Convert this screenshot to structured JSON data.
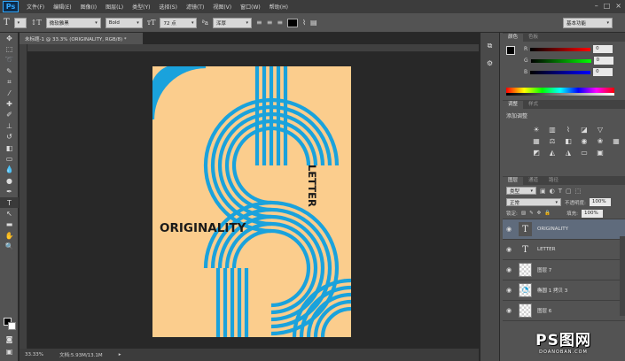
{
  "app": {
    "logo": "Ps"
  },
  "menu": [
    "文件(F)",
    "编辑(E)",
    "图像(I)",
    "图层(L)",
    "类型(Y)",
    "选择(S)",
    "滤镜(T)",
    "视图(V)",
    "窗口(W)",
    "帮助(H)"
  ],
  "window_controls": [
    "–",
    "□",
    "×"
  ],
  "options": {
    "font_family": "微软雅黑",
    "font_style": "Bold",
    "font_size": "72 点",
    "antialias": "浑厚",
    "text_color": "#000000",
    "workspace": "基本功能"
  },
  "document": {
    "tab_title": "未标题-1 @ 33.3% (ORIGINALITY, RGB/8) *",
    "zoom": "33.33%",
    "file_info": "文档:5.93M/13.1M",
    "poster": {
      "background": "#fbcd8d",
      "stripe_color": "#1aa2dc",
      "text_horizontal": "ORIGINALITY",
      "text_vertical": "LETTER"
    }
  },
  "color_panel": {
    "tabs": [
      "颜色",
      "色板"
    ],
    "channels": [
      {
        "label": "R",
        "value": "0"
      },
      {
        "label": "G",
        "value": "0"
      },
      {
        "label": "B",
        "value": "0"
      }
    ]
  },
  "adjustments_panel": {
    "tabs": [
      "调整",
      "样式"
    ],
    "heading": "添加调整"
  },
  "layers_panel": {
    "tabs": [
      "图层",
      "通道",
      "路径"
    ],
    "filter_label": "类型",
    "blend_mode": "正常",
    "opacity_label": "不透明度:",
    "opacity_value": "100%",
    "lock_label": "锁定:",
    "fill_label": "填充:",
    "fill_value": "100%",
    "layers": [
      {
        "name": "ORIGINALITY",
        "kind": "text",
        "selected": true
      },
      {
        "name": "LETTER",
        "kind": "text",
        "selected": false
      },
      {
        "name": "图层 7",
        "kind": "raster",
        "selected": false
      },
      {
        "name": "椭圆 1 拷贝 3",
        "kind": "shape",
        "selected": false
      },
      {
        "name": "图层 6",
        "kind": "raster",
        "selected": false
      }
    ]
  },
  "watermark": {
    "main": "PS图网",
    "sub": "DOANOBAN.COM"
  }
}
